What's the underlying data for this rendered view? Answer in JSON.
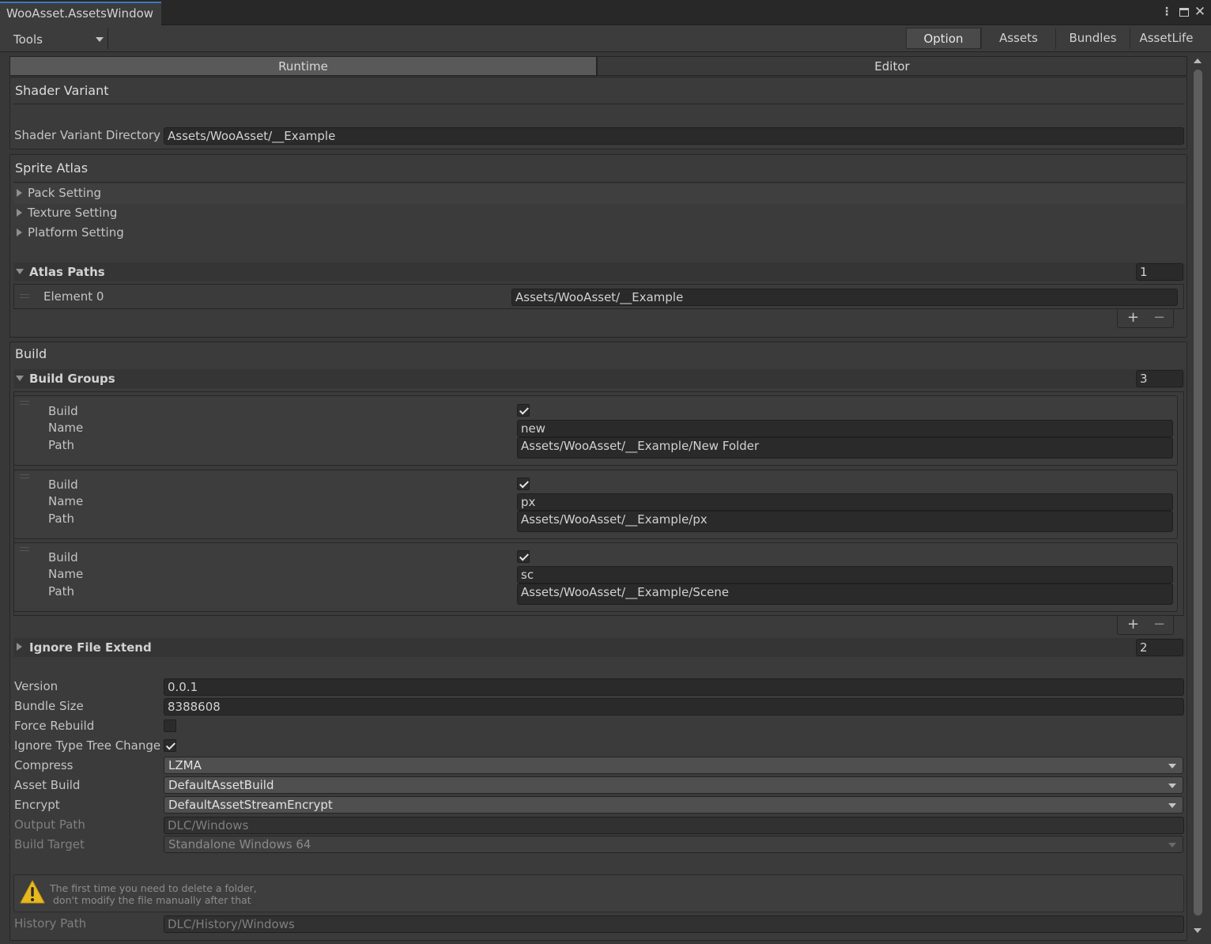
{
  "window": {
    "title": "WooAsset.AssetsWindow"
  },
  "toolbar": {
    "tools_label": "Tools",
    "tabs": [
      {
        "label": "Option",
        "active": true
      },
      {
        "label": "Assets",
        "active": false
      },
      {
        "label": "Bundles",
        "active": false
      },
      {
        "label": "AssetLife",
        "active": false
      }
    ]
  },
  "mode_tabs": [
    {
      "label": "Runtime",
      "active": true
    },
    {
      "label": "Editor",
      "active": false
    }
  ],
  "shader_variant": {
    "title": "Shader Variant",
    "directory_label": "Shader Variant Directory",
    "directory_value": "Assets/WooAsset/__Example"
  },
  "sprite_atlas": {
    "title": "Sprite Atlas",
    "foldouts": [
      "Pack Setting",
      "Texture Setting",
      "Platform Setting"
    ],
    "atlas_paths": {
      "label": "Atlas Paths",
      "count": "1",
      "elements": [
        {
          "label": "Element 0",
          "value": "Assets/WooAsset/__Example"
        }
      ]
    }
  },
  "build": {
    "title": "Build",
    "groups_label": "Build Groups",
    "groups_count": "3",
    "field_labels": {
      "build": "Build",
      "name": "Name",
      "path": "Path"
    },
    "groups": [
      {
        "build": true,
        "name": "new",
        "path": "Assets/WooAsset/__Example/New Folder"
      },
      {
        "build": true,
        "name": "px",
        "path": "Assets/WooAsset/__Example/px"
      },
      {
        "build": true,
        "name": "sc",
        "path": "Assets/WooAsset/__Example/Scene"
      }
    ],
    "ignore_file_extend": {
      "label": "Ignore File Extend",
      "count": "2"
    },
    "version": {
      "label": "Version",
      "value": "0.0.1"
    },
    "bundle_size": {
      "label": "Bundle Size",
      "value": "8388608"
    },
    "force_rebuild": {
      "label": "Force Rebuild",
      "checked": false
    },
    "ignore_type_tree": {
      "label": "Ignore Type Tree Change:",
      "checked": true
    },
    "compress": {
      "label": "Compress",
      "value": "LZMA"
    },
    "asset_build": {
      "label": "Asset Build",
      "value": "DefaultAssetBuild"
    },
    "encrypt": {
      "label": "Encrypt",
      "value": "DefaultAssetStreamEncrypt"
    },
    "output_path": {
      "label": "Output Path",
      "value": "DLC/Windows"
    },
    "build_target": {
      "label": "Build Target",
      "value": "Standalone Windows 64"
    },
    "warning": {
      "line1": "The first time you need to delete a folder,",
      "line2": "don't modify the file manually after that"
    },
    "history_path": {
      "label": "History Path",
      "value": "DLC/History/Windows"
    }
  },
  "list_buttons": {
    "add": "+",
    "remove": "−"
  },
  "colors": {
    "accent": "#3a79bb",
    "background": "#383838",
    "warning": "#e8b91e"
  },
  "icons": [
    "kebab-menu-icon",
    "maximize-icon",
    "close-icon",
    "warning-icon",
    "checkmark-icon",
    "foldout-arrow-icon",
    "dropdown-caret-icon",
    "drag-handle-icon"
  ]
}
